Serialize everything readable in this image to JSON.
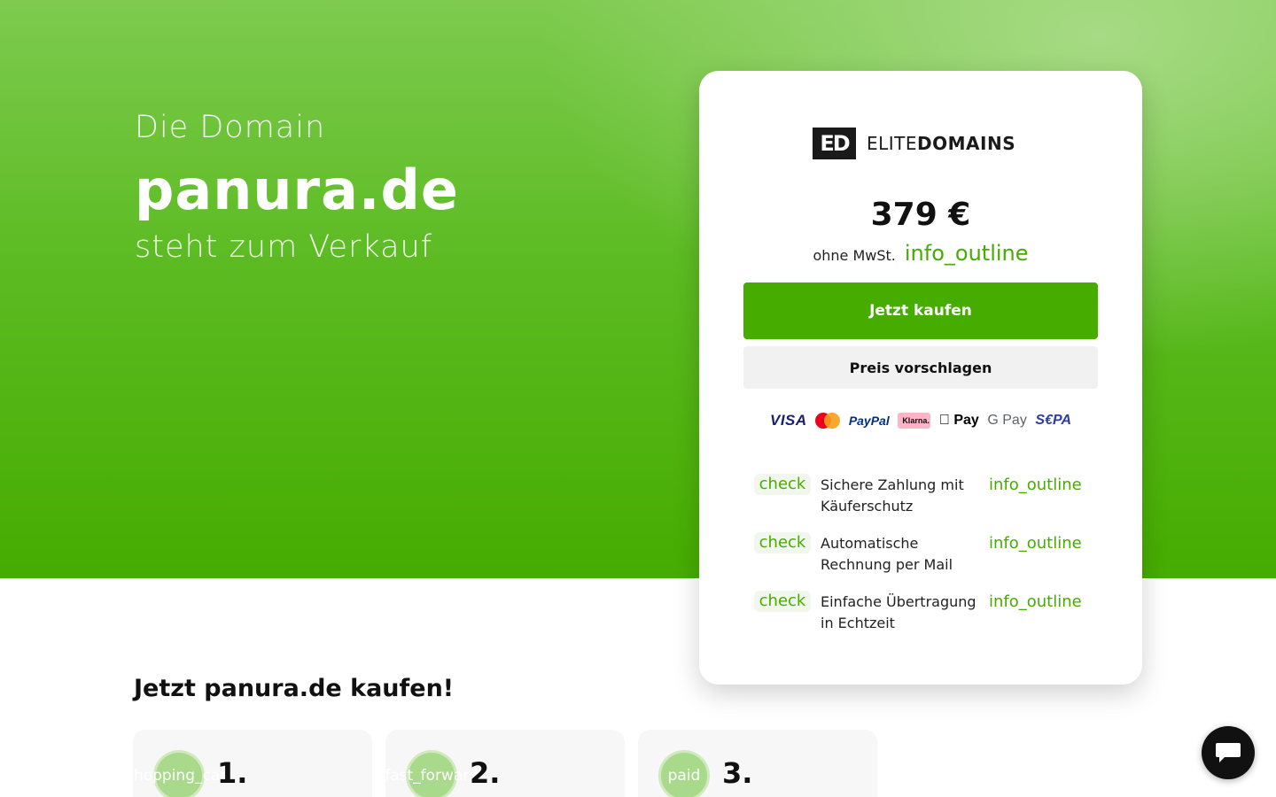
{
  "hero": {
    "pre": "Die Domain",
    "domain": "panura.de",
    "post": "steht zum Verkauf"
  },
  "card": {
    "logo": {
      "mark": "ED",
      "text_light": "ELITE",
      "text_bold": "DOMAINS"
    },
    "price": "379 €",
    "vat_label": "ohne MwSt.",
    "vat_icon": "info_outline",
    "buy_button": "Jetzt kaufen",
    "offer_button": "Preis vorschlagen",
    "payments": {
      "visa": "VISA",
      "paypal": "PayPal",
      "klarna": "Klarna.",
      "apple": " Pay",
      "gpay": "G Pay",
      "sepa": "S€PA"
    },
    "features": [
      {
        "icon": "check",
        "text": "Sichere Zahlung mit Käuferschutz",
        "info": "info_outline"
      },
      {
        "icon": "check",
        "text": "Automatische Rechnung per Mail",
        "info": "info_outline"
      },
      {
        "icon": "check",
        "text": "Einfache Übertragung in Echtzeit",
        "info": "info_outline"
      }
    ]
  },
  "section": {
    "heading": "Jetzt panura.de kaufen!"
  },
  "steps": [
    {
      "icon": "shopping_cart",
      "num": "1."
    },
    {
      "icon": "fast_forward",
      "num": "2."
    },
    {
      "icon": "paid",
      "num": "3."
    }
  ],
  "colors": {
    "accent": "#46ac00",
    "dark": "#111111"
  }
}
